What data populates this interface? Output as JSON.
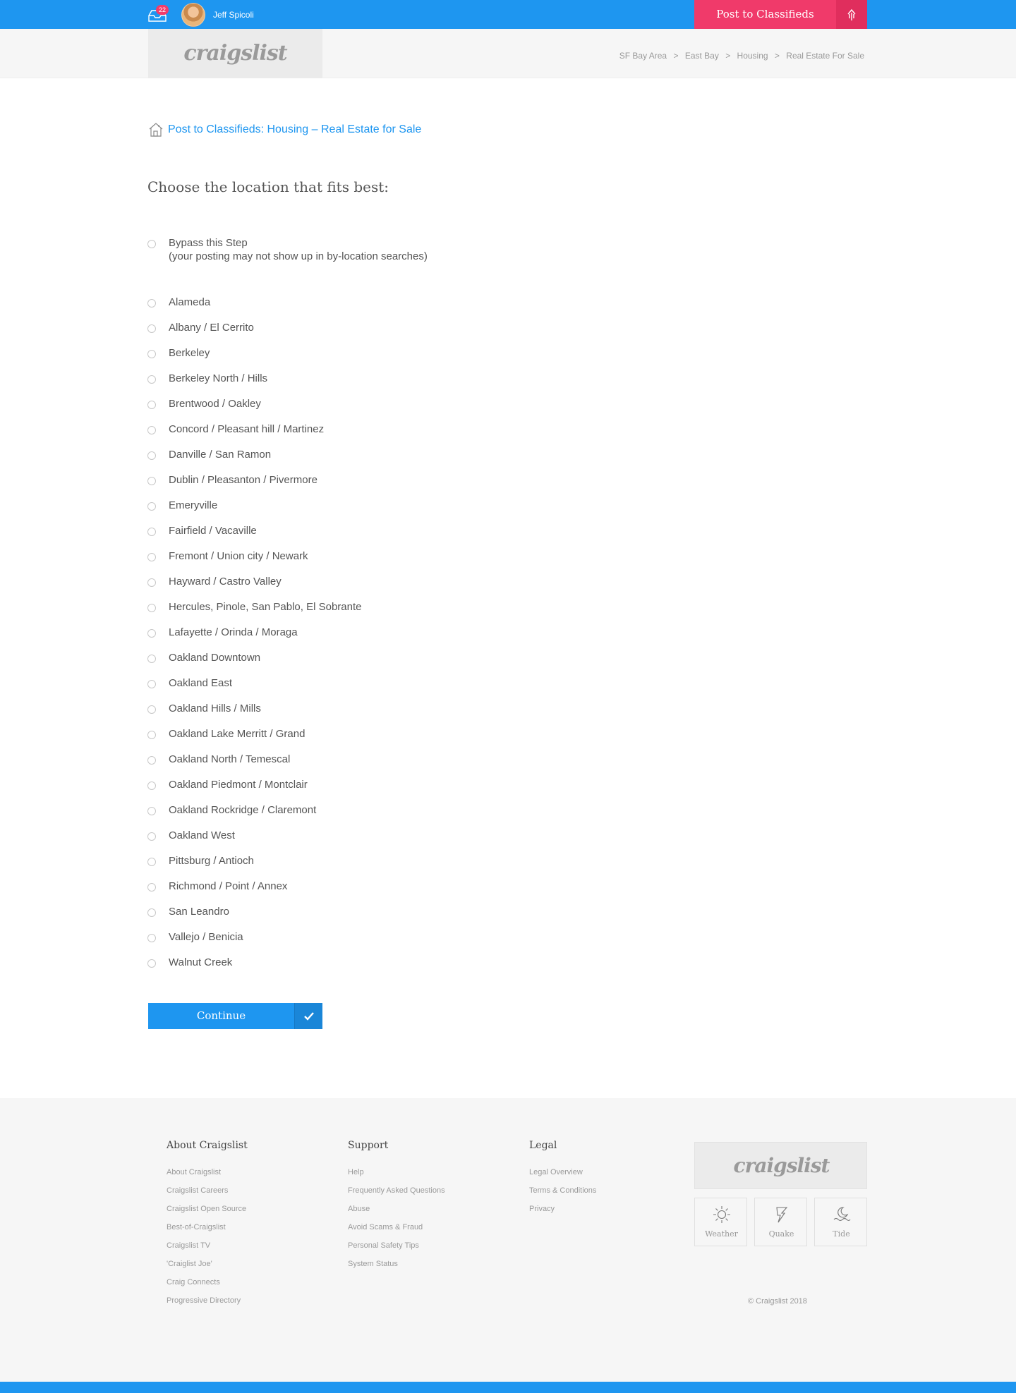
{
  "topbar": {
    "inbox_count": "22",
    "username": "Jeff Spicoli",
    "post_button": "Post to Classifieds",
    "accent": "#1e96f0",
    "post_color": "#f03a6a"
  },
  "header": {
    "logo": "craigslist",
    "breadcrumb": [
      "SF Bay Area",
      "East Bay",
      "Housing",
      "Real Estate For Sale"
    ],
    "separator": ">"
  },
  "main": {
    "page_link": "Post to Classifieds: Housing – Real Estate for Sale",
    "heading": "Choose the location that fits best:",
    "bypass_label": "Bypass this Step",
    "bypass_note": "(your posting may not show up in by-location searches)",
    "locations": [
      "Alameda",
      "Albany / El Cerrito",
      "Berkeley",
      "Berkeley North / Hills",
      "Brentwood / Oakley",
      "Concord / Pleasant hill / Martinez",
      "Danville / San Ramon",
      "Dublin / Pleasanton / Pivermore",
      "Emeryville",
      "Fairfield / Vacaville",
      "Fremont / Union city / Newark",
      "Hayward / Castro Valley",
      "Hercules, Pinole, San Pablo, El Sobrante",
      "Lafayette / Orinda / Moraga",
      "Oakland Downtown",
      "Oakland East",
      "Oakland Hills / Mills",
      "Oakland Lake Merritt / Grand",
      "Oakland North / Temescal",
      "Oakland Piedmont / Montclair",
      "Oakland Rockridge / Claremont",
      "Oakland West",
      "Pittsburg / Antioch",
      "Richmond / Point / Annex",
      "San Leandro",
      "Vallejo / Benicia",
      "Walnut Creek"
    ],
    "continue_label": "Continue"
  },
  "footer": {
    "about": {
      "title": "About Craigslist",
      "links": [
        "About Craigslist",
        "Craigslist Careers",
        "Craigslist Open Source",
        "Best-of-Craigslist",
        "Craigslist TV",
        "'Craiglist Joe'",
        "Craig Connects",
        "Progressive Directory"
      ]
    },
    "support": {
      "title": "Support",
      "links": [
        "Help",
        "Frequently Asked Questions",
        "Abuse",
        "Avoid Scams & Fraud",
        "Personal Safety Tips",
        "System Status"
      ]
    },
    "legal": {
      "title": "Legal",
      "links": [
        "Legal Overview",
        "Terms & Conditions",
        "Privacy"
      ]
    },
    "logo": "craigslist",
    "widgets": [
      {
        "label": "Weather",
        "icon": "sun-icon"
      },
      {
        "label": "Quake",
        "icon": "quake-icon"
      },
      {
        "label": "Tide",
        "icon": "tide-icon"
      }
    ],
    "copyright": "© Craigslist 2018"
  }
}
